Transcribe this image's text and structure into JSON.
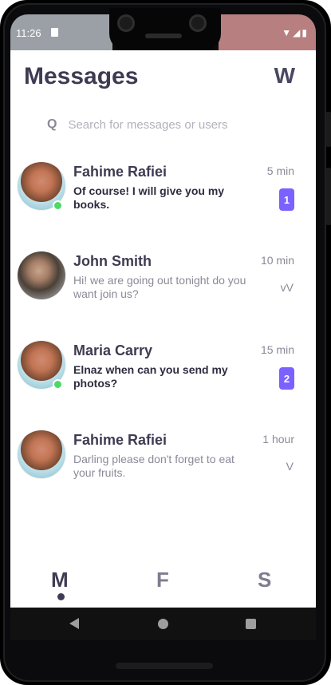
{
  "status_bar": {
    "time": "11:26",
    "icons_label": "▼◢▮"
  },
  "header": {
    "title": "Messages",
    "profile_letter": "W"
  },
  "search": {
    "icon_glyph": "Q",
    "placeholder": "Search for messages or users"
  },
  "chats": [
    {
      "name": "Fahime Rafiei",
      "preview": "Of course! I will give you my books.",
      "time": "5 min",
      "unread_count": "1",
      "online": true,
      "status_mark": ""
    },
    {
      "name": "John Smith",
      "preview": "Hi! we are going out tonight do you want join us?",
      "time": "10 min",
      "unread_count": "",
      "online": false,
      "status_mark": "vV"
    },
    {
      "name": "Maria Carry",
      "preview": "Elnaz when can you send my photos?",
      "time": "15 min",
      "unread_count": "2",
      "online": true,
      "status_mark": ""
    },
    {
      "name": "Fahime Rafiei",
      "preview": "Darling please don't forget to eat your fruits.",
      "time": "1 hour",
      "unread_count": "",
      "online": false,
      "status_mark": "V"
    }
  ],
  "bottom_nav": {
    "items": [
      "M",
      "F",
      "S"
    ],
    "active": "M"
  },
  "colors": {
    "accent": "#7b61ff",
    "title": "#3e3b52",
    "online": "#4cd964"
  }
}
